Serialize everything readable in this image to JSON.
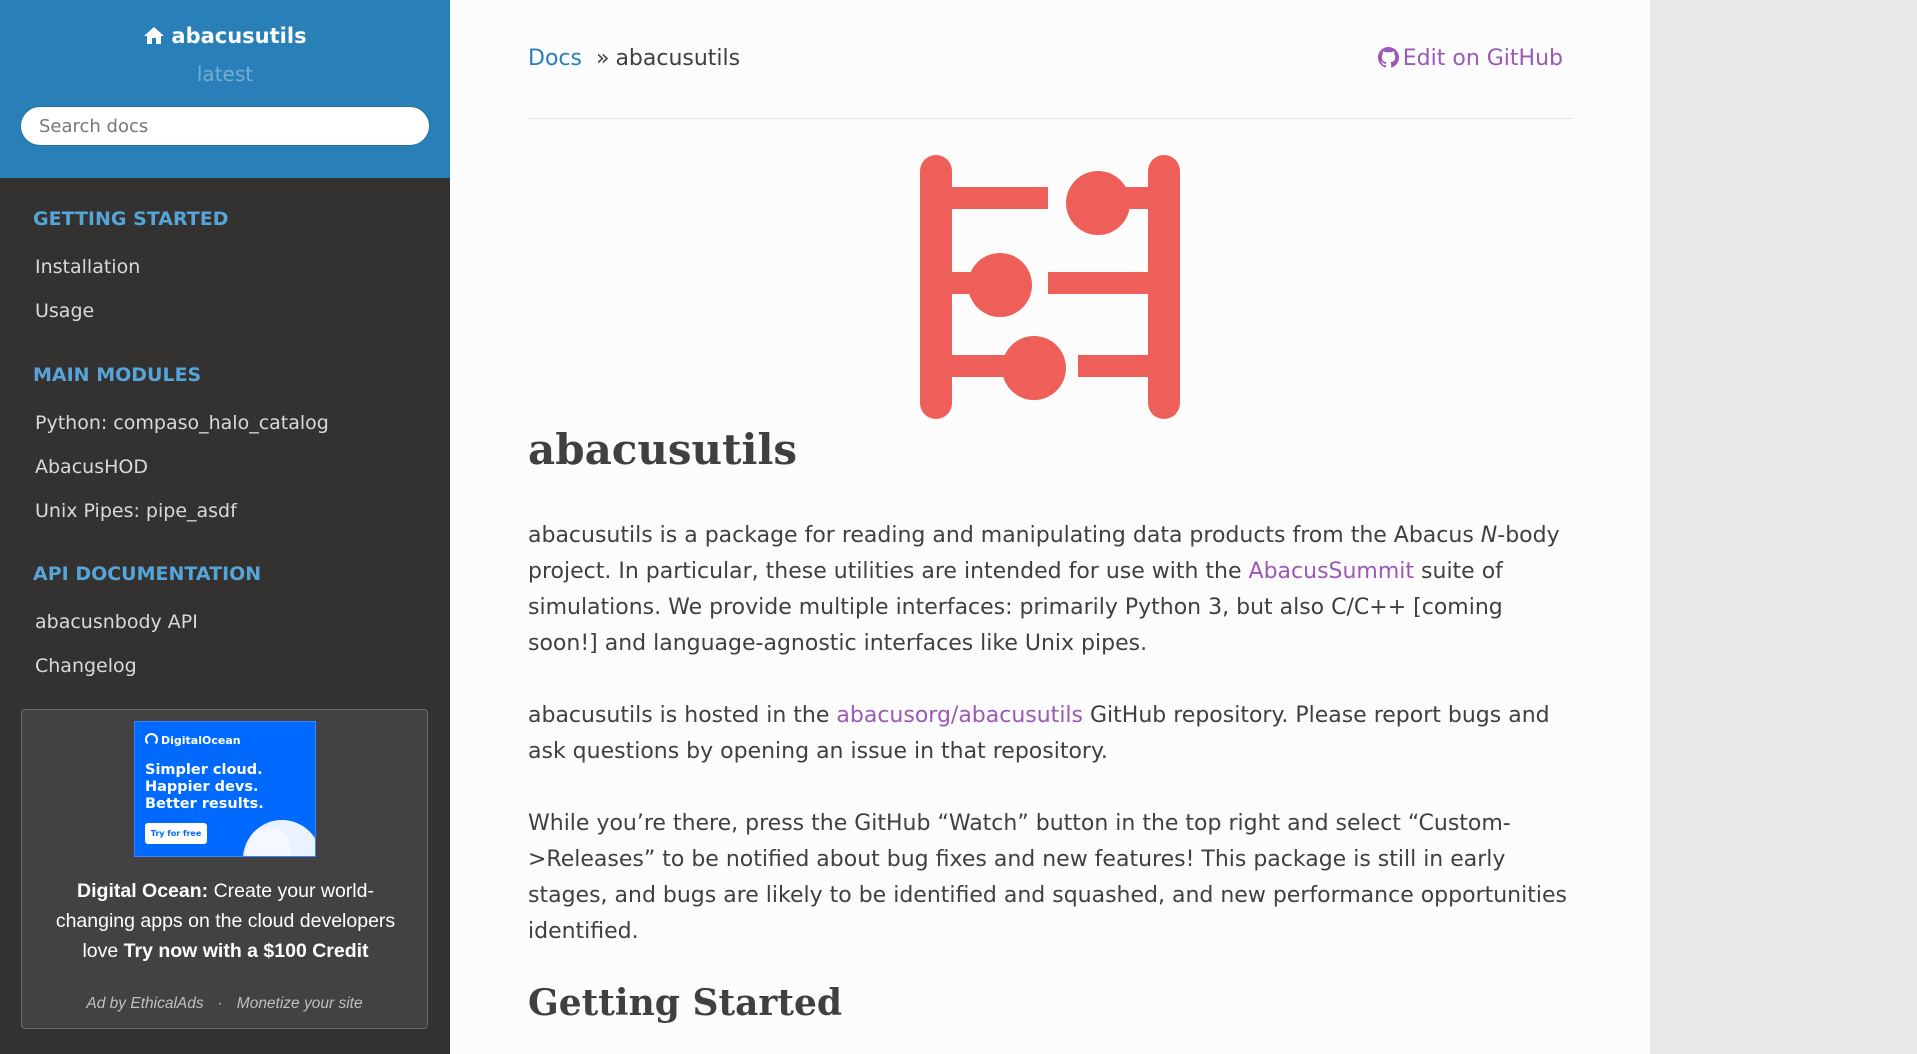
{
  "sidebar": {
    "project_name": "abacusutils",
    "version": "latest",
    "search_placeholder": "Search docs",
    "sections": [
      {
        "caption": "GETTING STARTED",
        "items": [
          "Installation",
          "Usage"
        ]
      },
      {
        "caption": "MAIN MODULES",
        "items": [
          "Python: compaso_halo_catalog",
          "AbacusHOD",
          "Unix Pipes: pipe_asdf"
        ]
      },
      {
        "caption": "API DOCUMENTATION",
        "items": [
          "abacusnbody API",
          "Changelog"
        ]
      }
    ],
    "ad": {
      "image_brand": "DigitalOcean",
      "image_tagline": [
        "Simpler cloud.",
        "Happier devs.",
        "Better results."
      ],
      "image_button": "Try for free",
      "advertiser": "Digital Ocean:",
      "body": " Create your world-changing apps on the cloud developers love ",
      "cta": "Try now with a $100 Credit",
      "footer_left": "Ad by EthicalAds",
      "footer_sep": "·",
      "footer_right": "Monetize your site"
    }
  },
  "breadcrumbs": {
    "root": "Docs",
    "separator": "»",
    "current": "abacusutils"
  },
  "edit_link": "Edit on GitHub",
  "page": {
    "title": "abacusutils",
    "p1_a": "abacusutils is a package for reading and manipulating data products from the Abacus ",
    "p1_em": "N",
    "p1_b": "-body project. In particular, these utilities are intended for use with the ",
    "p1_link": "AbacusSummit",
    "p1_c": " suite of simulations. We provide multiple interfaces: primarily Python 3, but also C/C++ [coming soon!] and language-agnostic interfaces like Unix pipes.",
    "p2_a": "abacusutils is hosted in the ",
    "p2_link": "abacusorg/abacusutils",
    "p2_b": " GitHub repository. Please report bugs and ask questions by opening an issue in that repository.",
    "p3": "While you’re there, press the GitHub “Watch” button in the top right and select “Custom->Releases” to be notified about bug fixes and new features! This package is still in early stages, and bugs are likely to be identified and squashed, and new performance opportunities identified.",
    "section_heading": "Getting Started"
  },
  "colors": {
    "sidebar_top": "#2980b9",
    "sidebar_bg": "#343131",
    "caption": "#55a5d9",
    "link": "#2980b9",
    "visited_link": "#9b59b6",
    "logo": "#ef5f5a"
  }
}
